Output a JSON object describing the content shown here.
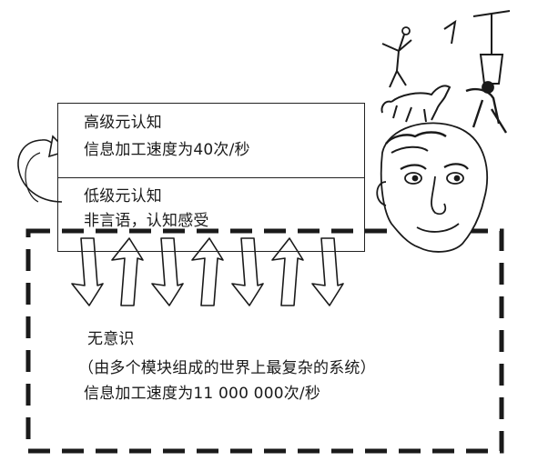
{
  "diagram": {
    "upper_layer": {
      "title": "高级元认知",
      "detail": "信息加工速度为40次/秒"
    },
    "lower_layer": {
      "title": "低级元认知",
      "detail": "非言语，认知感受"
    },
    "unconscious": {
      "title": "无意识",
      "detail": "（由多个模块组成的世界上最复杂的系统）",
      "speed": "信息加工速度为11 000 000次/秒"
    },
    "arrow_directions": [
      "down",
      "up",
      "down",
      "up",
      "down",
      "up",
      "down"
    ],
    "illustration_icon": "cartoon-head-with-thoughts-icon"
  }
}
